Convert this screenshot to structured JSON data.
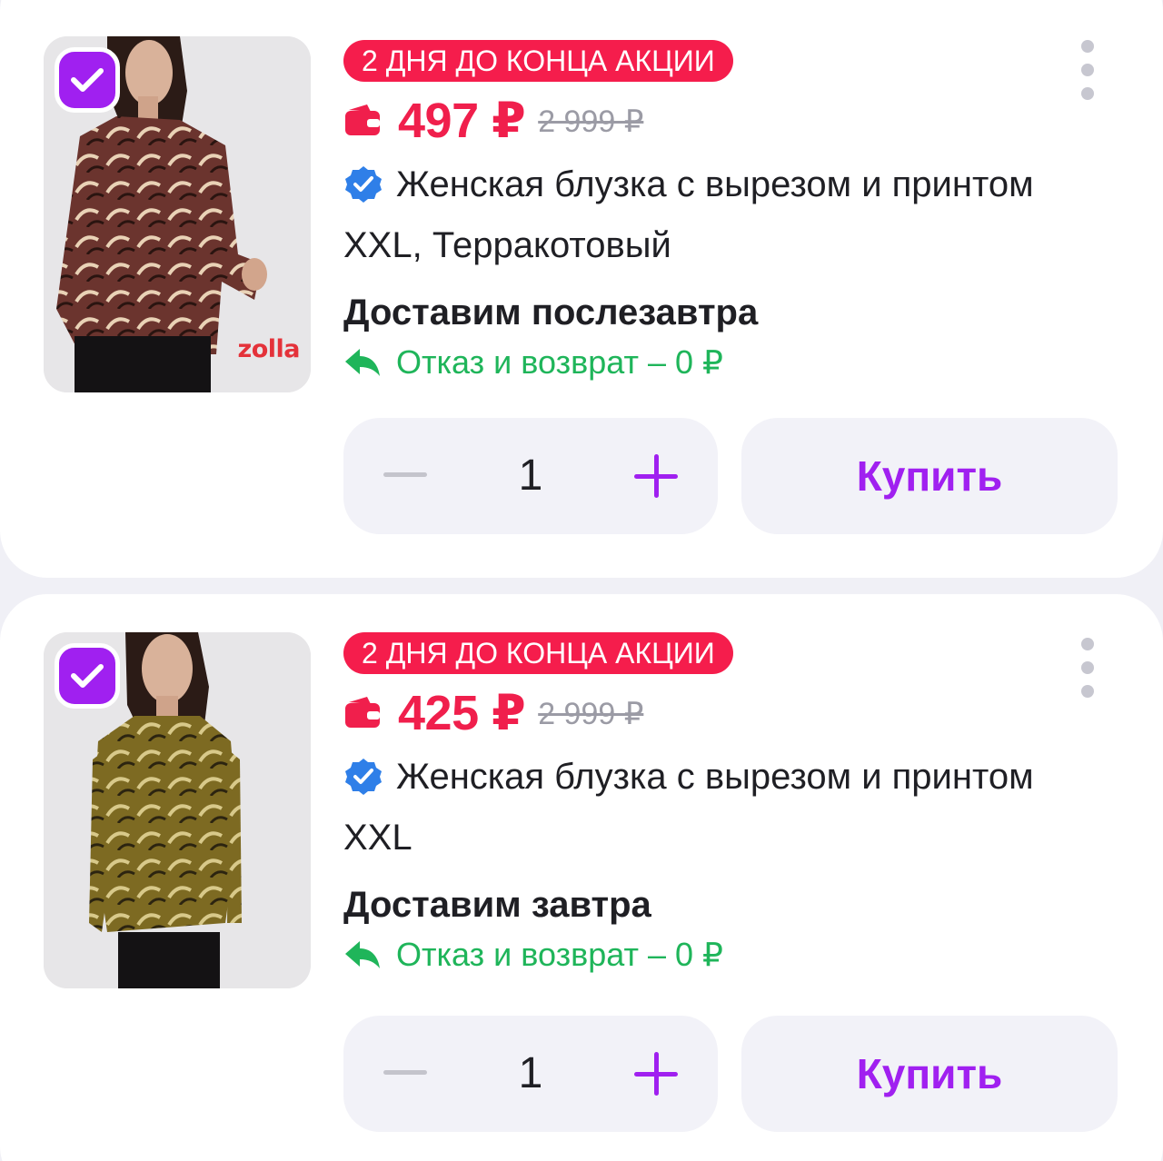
{
  "items": [
    {
      "promo": "2 ДНЯ ДО КОНЦА АКЦИИ",
      "price": "497 ₽",
      "old_price": "2 999 ₽",
      "title": "Женская блузка с вырезом и принтом",
      "variant": "XXL, Терракотовый",
      "delivery": "Доставим послезавтра",
      "return_policy": "Отказ и возврат – 0 ₽",
      "quantity": "1",
      "buy_label": "Купить",
      "brand_logo": "zolla",
      "selected": true,
      "shirt_color": "#6b342e"
    },
    {
      "promo": "2 ДНЯ ДО КОНЦА АКЦИИ",
      "price": "425 ₽",
      "old_price": "2 999 ₽",
      "title": "Женская блузка с вырезом и принтом",
      "variant": "XXL",
      "delivery": "Доставим завтра",
      "return_policy": "Отказ и возврат – 0 ₽",
      "quantity": "1",
      "buy_label": "Купить",
      "selected": true,
      "shirt_color": "#7d6a22"
    }
  ],
  "colors": {
    "accent": "#a020f0",
    "price_red": "#f01f4c",
    "promo_bg": "#f51d4c",
    "return_green": "#1fb55a",
    "verified_blue": "#2f7fe8"
  }
}
